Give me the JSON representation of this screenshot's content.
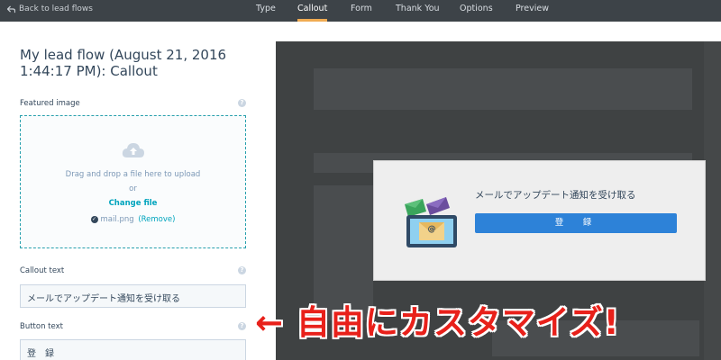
{
  "nav": {
    "back_label": "Back to lead flows",
    "tabs": [
      {
        "label": "Type"
      },
      {
        "label": "Callout"
      },
      {
        "label": "Form"
      },
      {
        "label": "Thank You"
      },
      {
        "label": "Options"
      },
      {
        "label": "Preview"
      }
    ],
    "active_tab": "Callout",
    "accent_color": "#f0ab52"
  },
  "editor": {
    "title": "My lead flow (August 21, 2016 1:44:17 PM): Callout",
    "featured_image": {
      "label": "Featured image",
      "drop_text": "Drag and drop a file here to upload",
      "or_text": "or",
      "change_file_label": "Change file",
      "file_name": "mail.png",
      "remove_label": "(Remove)"
    },
    "callout_text": {
      "label": "Callout text",
      "value": "メールでアップデート通知を受け取る"
    },
    "button_text": {
      "label": "Button text",
      "value": "登　録"
    }
  },
  "preview": {
    "callout_text": "メールでアップデート通知を受け取る",
    "button_label": "登　録",
    "button_color": "#2d82d8"
  },
  "annotation": {
    "arrow": "←",
    "text": "自由にカスタマイズ!",
    "color": "#e8201a"
  }
}
